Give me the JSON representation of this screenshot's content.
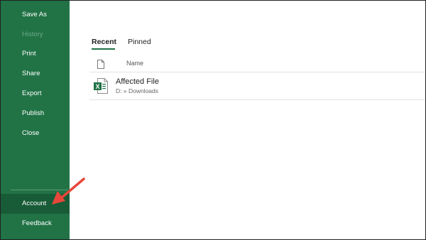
{
  "sidebar": {
    "items": [
      {
        "label": "Save As",
        "state": "normal"
      },
      {
        "label": "History",
        "state": "disabled"
      },
      {
        "label": "Print",
        "state": "normal"
      },
      {
        "label": "Share",
        "state": "normal"
      },
      {
        "label": "Export",
        "state": "normal"
      },
      {
        "label": "Publish",
        "state": "normal"
      },
      {
        "label": "Close",
        "state": "normal"
      }
    ],
    "bottom_items": [
      {
        "label": "Account",
        "state": "highlighted"
      },
      {
        "label": "Feedback",
        "state": "normal"
      }
    ]
  },
  "tabs": [
    {
      "label": "Recent",
      "active": true
    },
    {
      "label": "Pinned",
      "active": false
    }
  ],
  "file_list": {
    "header": {
      "name_label": "Name",
      "icon": "document-icon"
    },
    "files": [
      {
        "name": "Affected File",
        "path": "D: » Downloads",
        "icon": "excel-file-icon"
      }
    ]
  },
  "annotation": {
    "type": "arrow",
    "color": "#e8463a",
    "target": "Account"
  },
  "colors": {
    "sidebar_bg": "#217346",
    "sidebar_active": "#185c37",
    "accent": "#217346",
    "arrow": "#e8463a"
  }
}
